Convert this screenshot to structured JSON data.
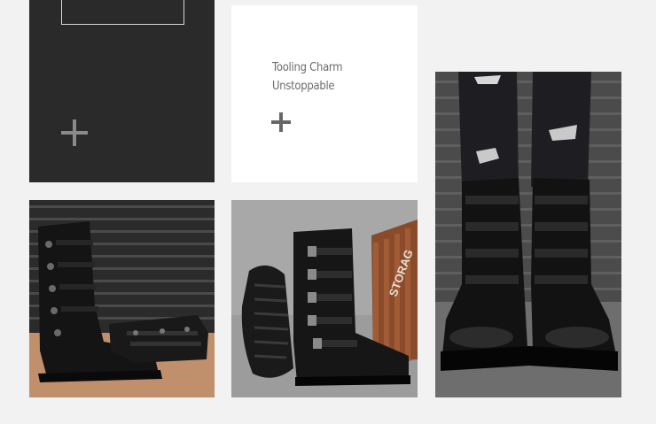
{
  "caption": {
    "line1": "Tooling Charm",
    "line2": "Unstoppable"
  },
  "icons": {
    "dark_tile": "plus-icon",
    "white_tile": "plus-icon"
  },
  "photos": {
    "crate_text": "STORAG"
  },
  "colors": {
    "background": "#f2f2f2",
    "dark_tile": "#2a2a2a",
    "caption_text": "#6b6b6b"
  }
}
